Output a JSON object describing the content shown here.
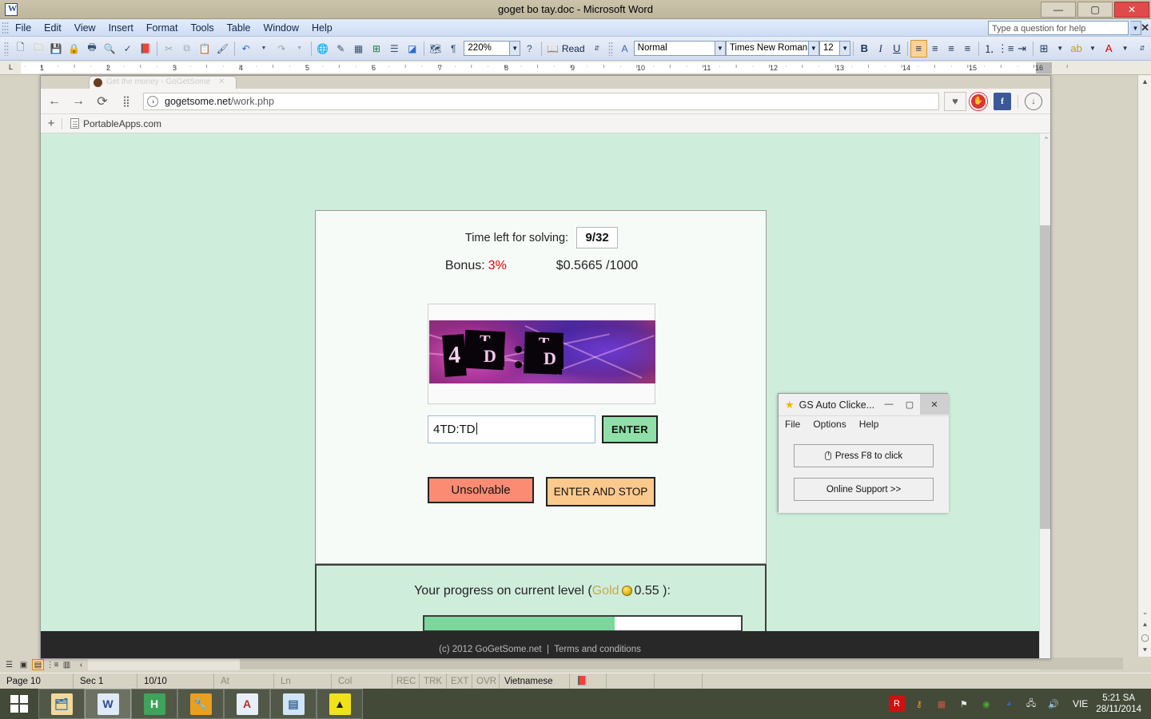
{
  "word": {
    "title": "goget bo tay.doc - Microsoft Word",
    "doc_icon": "word-document-icon",
    "window_controls": {
      "minimize": "—",
      "maximize": "▢",
      "close": "✕"
    },
    "menus": [
      "File",
      "Edit",
      "View",
      "Insert",
      "Format",
      "Tools",
      "Table",
      "Window",
      "Help"
    ],
    "help_placeholder": "Type a question for help",
    "help_close": "✕",
    "toolbar": {
      "zoom": "220%",
      "style": "Normal",
      "font": "Times New Roman",
      "size": "12",
      "read_label": "Read",
      "bold": "B",
      "italic": "I",
      "underline": "U",
      "icons": [
        "new-document-icon",
        "open-folder-icon",
        "save-icon",
        "permission-icon",
        "print-icon",
        "print-preview-icon",
        "spelling-check-icon",
        "research-icon",
        "cut-icon",
        "copy-icon",
        "paste-icon",
        "format-painter-icon",
        "undo-icon",
        "redo-icon",
        "insert-hyperlink-icon",
        "drawing-icon",
        "insert-table-icon",
        "insert-excel-icon",
        "columns-icon",
        "drawing-toolbar-icon",
        "document-map-icon",
        "show-formatting-icon",
        "help-circle-icon"
      ]
    },
    "ruler_ticks": [
      "1",
      "2",
      "3",
      "4",
      "5",
      "6",
      "7",
      "8",
      "9",
      "10",
      "11",
      "12",
      "13",
      "14",
      "15",
      "16"
    ],
    "statusbar": {
      "page": "Page 10",
      "section": "Sec 1",
      "pages": "10/10",
      "at": "At",
      "ln": "Ln",
      "col": "Col",
      "rec": "REC",
      "trk": "TRK",
      "ext": "EXT",
      "ovr": "OVR",
      "language": "Vietnamese",
      "spellcheck_icon": "spelling-status-icon"
    },
    "view_buttons": [
      "normal-view",
      "web-layout-view",
      "print-layout-view",
      "outline-view",
      "reading-view"
    ]
  },
  "browser": {
    "tab": {
      "title": "Get the money - GoGetSome...",
      "close": "✕",
      "favicon": "site-favicon"
    },
    "nav": {
      "back": "←",
      "forward": "→",
      "reload": "⟳",
      "apps": "apps-grid-icon",
      "security_icon": "page-info-icon",
      "url_domain": "gogetsome.net",
      "url_path": "/work.php"
    },
    "extensions": [
      {
        "name": "heart-bookmark-icon",
        "glyph": "♥"
      },
      {
        "name": "adblock-icon",
        "glyph": "✋"
      },
      {
        "name": "facebook-icon",
        "glyph": "f"
      },
      {
        "name": "download-icon",
        "glyph": "↓"
      }
    ],
    "bookmarks": {
      "add": "+",
      "items": [
        {
          "label": "PortableApps.com",
          "icon": "page-icon"
        }
      ]
    }
  },
  "page": {
    "time_label": "Time left for solving:",
    "time_value": "9/32",
    "bonus_label": "Bonus:",
    "bonus_value": "3%",
    "earnings": "$0.5665 /1000",
    "captcha_text": "4TD:TD",
    "input_value": "4TD:TD",
    "enter_label": "ENTER",
    "unsolvable_label": "Unsolvable",
    "enter_stop_label": "ENTER AND STOP",
    "progress_prefix": "Your progress on current level (",
    "progress_gold": "Gold",
    "progress_coin": "gold-coin-icon",
    "progress_amount": "0.55",
    "progress_suffix": "):",
    "progress_percent": 60,
    "footer_copyright": "(c) 2012 GoGetSome.net",
    "footer_sep": "|",
    "footer_terms": "Terms and conditions",
    "colors": {
      "page_bg": "#cfeddb",
      "bonus_red": "#e30000",
      "enter_green": "#8fe0a8",
      "unsolvable_red": "#fb8b73",
      "enter_stop_orange": "#fcc98d",
      "progress_green": "#7bd79b",
      "gold_text": "#c8a94e"
    }
  },
  "gs_clicker": {
    "title": "GS Auto Clicke...",
    "star_icon": "star-icon",
    "controls": {
      "minimize": "—",
      "maximize": "▢",
      "close": "✕"
    },
    "menus": [
      "File",
      "Options",
      "Help"
    ],
    "press_button": "Press F8 to click",
    "press_icon": "mouse-icon",
    "support_button": "Online Support >>"
  },
  "taskbar": {
    "start_icon": "windows-start-icon",
    "apps": [
      {
        "name": "file-explorer-icon",
        "glyph": "🗂",
        "bg": "#f2d89a",
        "color": "#2a6ea8",
        "state": "open"
      },
      {
        "name": "microsoft-word-icon",
        "glyph": "W",
        "bg": "#dfe9f7",
        "color": "#2a4b8d",
        "state": "active"
      },
      {
        "name": "hamachi-icon",
        "glyph": "H",
        "bg": "#3fa35c",
        "color": "#ffffff",
        "state": "open"
      },
      {
        "name": "tools-keys-icon",
        "glyph": "🔧",
        "bg": "#e8a020",
        "color": "#7a4a00",
        "state": "open"
      },
      {
        "name": "text-editor-icon",
        "glyph": "A",
        "bg": "#e8eef8",
        "color": "#b03030",
        "state": "open"
      },
      {
        "name": "notepad-icon",
        "glyph": "▤",
        "bg": "#cfe4f5",
        "color": "#3a6a9a",
        "state": "open"
      },
      {
        "name": "warning-app-icon",
        "glyph": "▲",
        "bg": "#f2e21a",
        "color": "#222222",
        "state": "open"
      }
    ],
    "tray": [
      {
        "name": "avira-icon",
        "glyph": "R",
        "bg": "#d01010",
        "color": "#ffffff"
      },
      {
        "name": "keys-warning-icon",
        "glyph": "⚷",
        "bg": "transparent",
        "color": "#e8a020"
      },
      {
        "name": "apps-tray-icon",
        "glyph": "▦",
        "bg": "transparent",
        "color": "#d4553b"
      },
      {
        "name": "action-center-flag-icon",
        "glyph": "⚑",
        "bg": "transparent",
        "color": "#e8e8e8"
      },
      {
        "name": "nvidia-icon",
        "glyph": "◉",
        "bg": "transparent",
        "color": "#4ba82e"
      },
      {
        "name": "malwarebytes-icon",
        "glyph": "◕",
        "bg": "transparent",
        "color": "#2a6ad0"
      },
      {
        "name": "network-icon",
        "glyph": "🖧",
        "bg": "transparent",
        "color": "#e0e0e0"
      },
      {
        "name": "volume-icon",
        "glyph": "🔊",
        "bg": "transparent",
        "color": "#e0e0e0"
      }
    ],
    "language": "VIE",
    "time": "5:21 SA",
    "date": "28/11/2014"
  }
}
